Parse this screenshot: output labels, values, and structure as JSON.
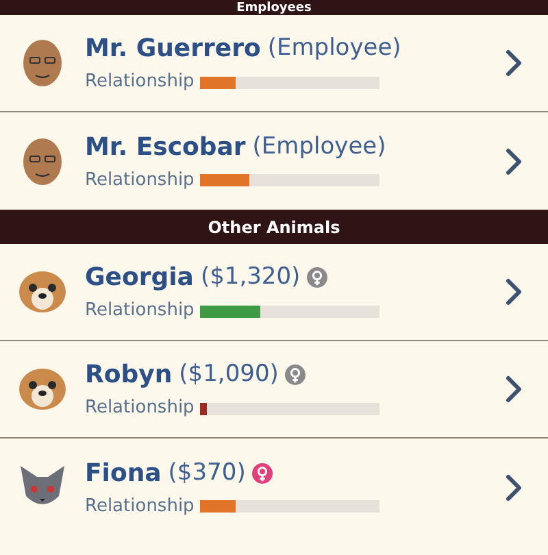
{
  "sections": [
    {
      "title": "Employees",
      "rows": [
        {
          "kind": "person",
          "name": "Mr. Guerrero",
          "detail": "(Employee)",
          "label": "Relationship",
          "level": 0.2,
          "color": "#e07428"
        },
        {
          "kind": "person",
          "name": "Mr. Escobar",
          "detail": "(Employee)",
          "label": "Relationship",
          "level": 0.28,
          "color": "#e07428"
        }
      ]
    },
    {
      "title": "Other Animals",
      "rows": [
        {
          "kind": "dog",
          "name": "Georgia",
          "detail": "($1,320)",
          "gender": {
            "kind": "female",
            "color": "#8a8a8a"
          },
          "label": "Relationship",
          "level": 0.34,
          "color": "#3f9a45"
        },
        {
          "kind": "dog",
          "name": "Robyn",
          "detail": "($1,090)",
          "gender": {
            "kind": "female",
            "color": "#8a8a8a"
          },
          "label": "Relationship",
          "level": 0.04,
          "color": "#9a2e22"
        },
        {
          "kind": "cat",
          "name": "Fiona",
          "detail": "($370)",
          "gender": {
            "kind": "female",
            "color": "#e0407a"
          },
          "label": "Relationship",
          "level": 0.2,
          "color": "#e07428"
        }
      ]
    }
  ]
}
